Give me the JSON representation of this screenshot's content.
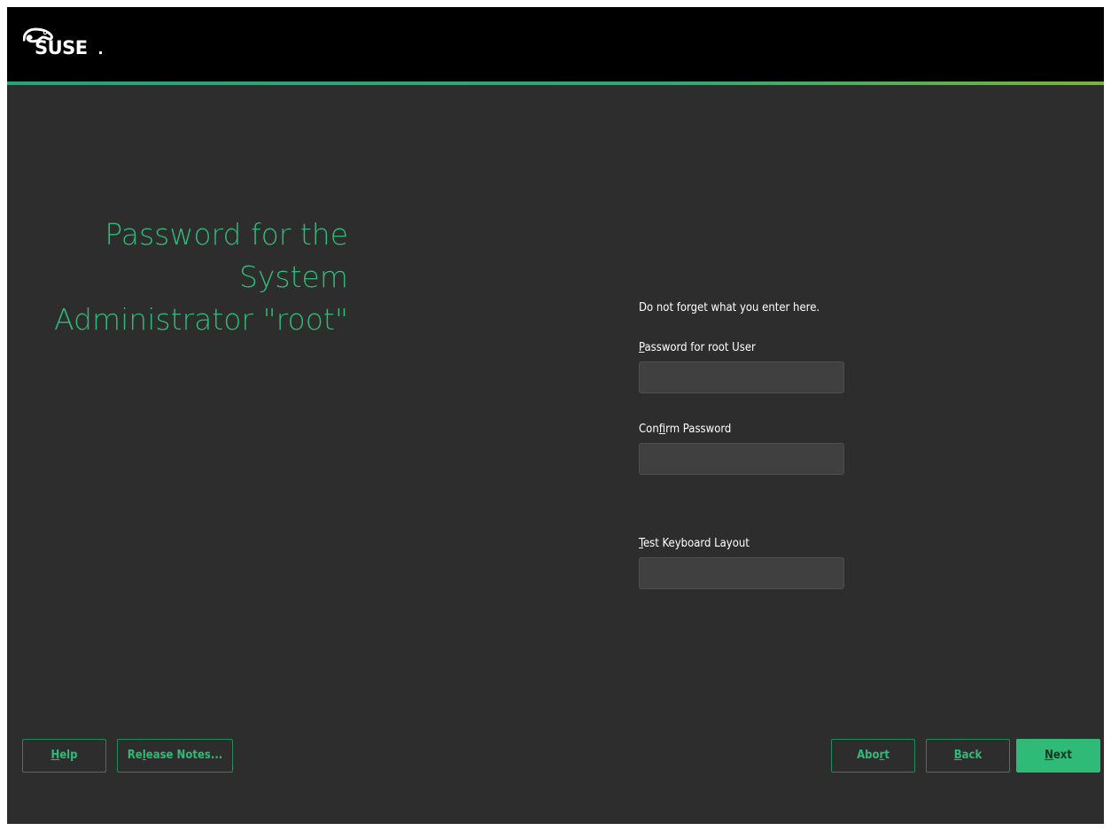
{
  "header": {
    "logo_text": "SUSE",
    "logo_icon": "suse-chameleon-icon",
    "accent_colors": [
      "#25a47a",
      "#7bb33c"
    ]
  },
  "title": {
    "lines": [
      "Password for the",
      "System",
      "Administrator \"root\""
    ],
    "color": "#30ba78"
  },
  "form": {
    "hint": "Do not forget what you enter here.",
    "password_label": {
      "before": "",
      "mnemonic": "P",
      "after": "assword for root User"
    },
    "password_value": "",
    "confirm_label": {
      "before": "Con",
      "mnemonic": "f",
      "after": "irm Password"
    },
    "confirm_value": "",
    "keyboard_label": {
      "before": "",
      "mnemonic": "T",
      "after": "est Keyboard Layout"
    },
    "keyboard_value": ""
  },
  "buttons": {
    "help": {
      "before": "",
      "mnemonic": "H",
      "after": "elp"
    },
    "release_notes": {
      "before": "Re",
      "mnemonic": "l",
      "after": "ease Notes..."
    },
    "abort": {
      "before": "Abo",
      "mnemonic": "r",
      "after": "t"
    },
    "back": {
      "before": "",
      "mnemonic": "B",
      "after": "ack"
    },
    "next": {
      "before": "",
      "mnemonic": "N",
      "after": "ext"
    }
  },
  "colors": {
    "background": "#2d2d2d",
    "header": "#000000",
    "accent_green": "#30ba78"
  }
}
